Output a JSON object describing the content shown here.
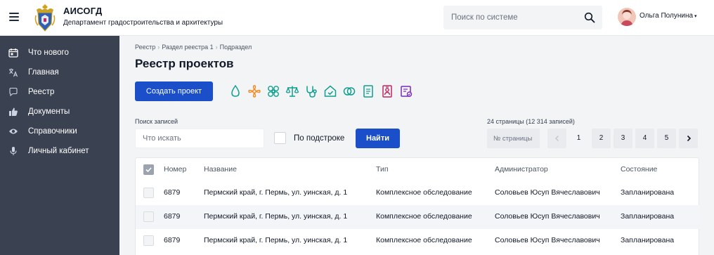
{
  "header": {
    "title": "АИСОГД",
    "subtitle": "Департамент градостроительства и архитектуры",
    "search_placeholder": "Поиск по системе",
    "user_name": "Ольга Полунина",
    "user_caret": "▾"
  },
  "sidebar": {
    "items": [
      {
        "label": "Что нового",
        "icon": "calendar-icon"
      },
      {
        "label": "Главная",
        "icon": "translate-icon"
      },
      {
        "label": "Реестр",
        "icon": "chat-bubble-icon"
      },
      {
        "label": "Документы",
        "icon": "thumbs-up-icon"
      },
      {
        "label": "Справочники",
        "icon": "eye-icon"
      },
      {
        "label": "Личный кабинет",
        "icon": "microphone-icon"
      }
    ]
  },
  "main": {
    "breadcrumb": [
      "Реестр",
      "Раздел реестра 1",
      "Подраздел"
    ],
    "breadcrumb_sep": "›",
    "title": "Реестр проектов",
    "create_label": "Создать проект",
    "category_icons": [
      {
        "name": "drop-icon",
        "color": "#0e9f8e"
      },
      {
        "name": "flower-icon",
        "color": "#f08a24"
      },
      {
        "name": "biohazard-icon",
        "color": "#0e9f8e"
      },
      {
        "name": "scales-icon",
        "color": "#0e9f8e"
      },
      {
        "name": "stethoscope-icon",
        "color": "#0e9f8e"
      },
      {
        "name": "home-icon",
        "color": "#0e9f8e"
      },
      {
        "name": "rings-icon",
        "color": "#0e9f8e"
      },
      {
        "name": "document-icon",
        "color": "#0e9f8e"
      },
      {
        "name": "id-card-icon",
        "color": "#c0265f"
      },
      {
        "name": "contract-icon",
        "color": "#7a2ab8"
      }
    ]
  },
  "search": {
    "label": "Поиск записей",
    "placeholder": "Что искать",
    "substring_label": "По подстроке",
    "find_label": "Найти"
  },
  "pagination": {
    "info": "24 страницы (12 314 записей)",
    "page_placeholder": "№ страницы",
    "pages": [
      "1",
      "2",
      "3",
      "4",
      "5"
    ],
    "current": "1"
  },
  "table": {
    "headers": {
      "number": "Номер",
      "name": "Название",
      "type": "Тип",
      "admin": "Администратор",
      "state": "Состояние"
    },
    "rows": [
      {
        "number": "6879",
        "name": "Пермский край, г. Пермь, ул. уинская, д. 1",
        "type": "Комплексное обследование",
        "admin": "Соловьев Юсуп Вячеславович",
        "state": "Запланирована"
      },
      {
        "number": "6879",
        "name": "Пермский край, г. Пермь, ул. уинская, д. 1",
        "type": "Комплексное обследование",
        "admin": "Соловьев Юсуп Вячеславович",
        "state": "Запланирована"
      },
      {
        "number": "6879",
        "name": "Пермский край, г. Пермь, ул. уинская, д. 1",
        "type": "Комплексное обследование",
        "admin": "Соловьев Юсуп Вячеславович",
        "state": "Запланирована"
      }
    ]
  },
  "colors": {
    "primary": "#1a4fc9",
    "sidebar": "#3a4151",
    "teal": "#0e9f8e"
  }
}
